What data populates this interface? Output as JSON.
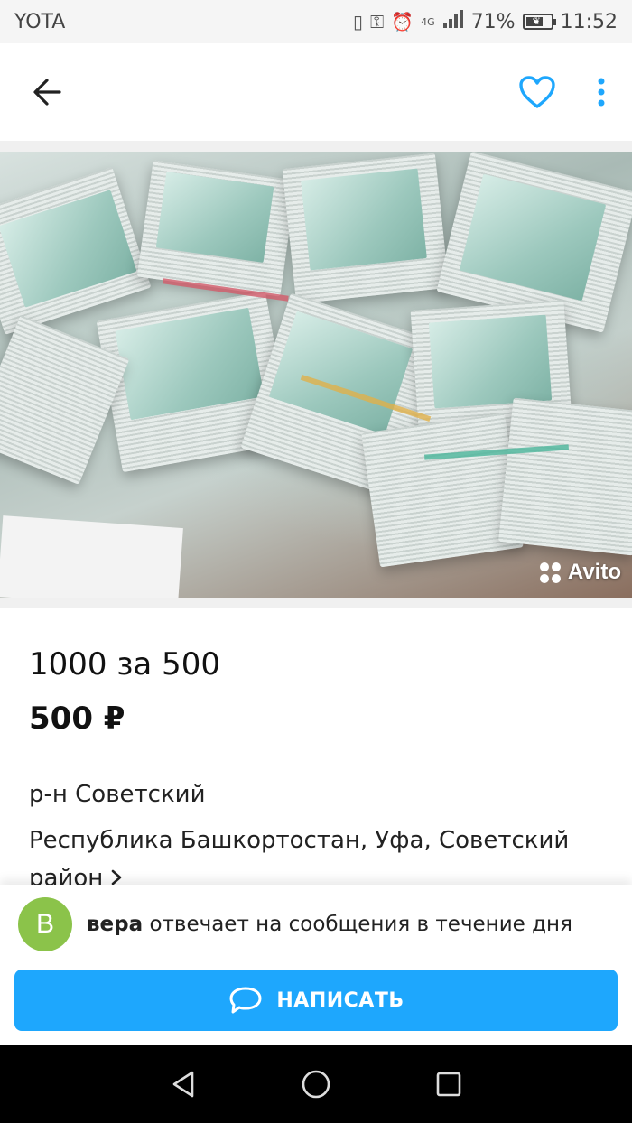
{
  "status_bar": {
    "carrier": "YOTA",
    "network": "4G",
    "battery_percent": "71%",
    "battery_level": 0.71,
    "time": "11:52"
  },
  "app_bar": {
    "back_icon": "arrow-left-icon",
    "favorite_icon": "heart-outline-icon",
    "menu_icon": "more-vertical-icon",
    "accent_color": "#1ea7fd"
  },
  "photo": {
    "watermark": "Avito"
  },
  "listing": {
    "title": "1000 за 500",
    "price": "500 ₽",
    "district": "р-н Советский",
    "address": "Республика Башкортостан, Уфа, Советский район"
  },
  "seller": {
    "avatar_letter": "В",
    "avatar_color": "#8bc34a",
    "name": "вера",
    "response_text": " отвечает на сообщения в течение дня"
  },
  "action": {
    "write_label": "НАПИСАТЬ",
    "button_color": "#1ea7fd"
  },
  "nav_bar": {
    "back": "triangle-back-icon",
    "home": "circle-home-icon",
    "recents": "square-recents-icon"
  }
}
